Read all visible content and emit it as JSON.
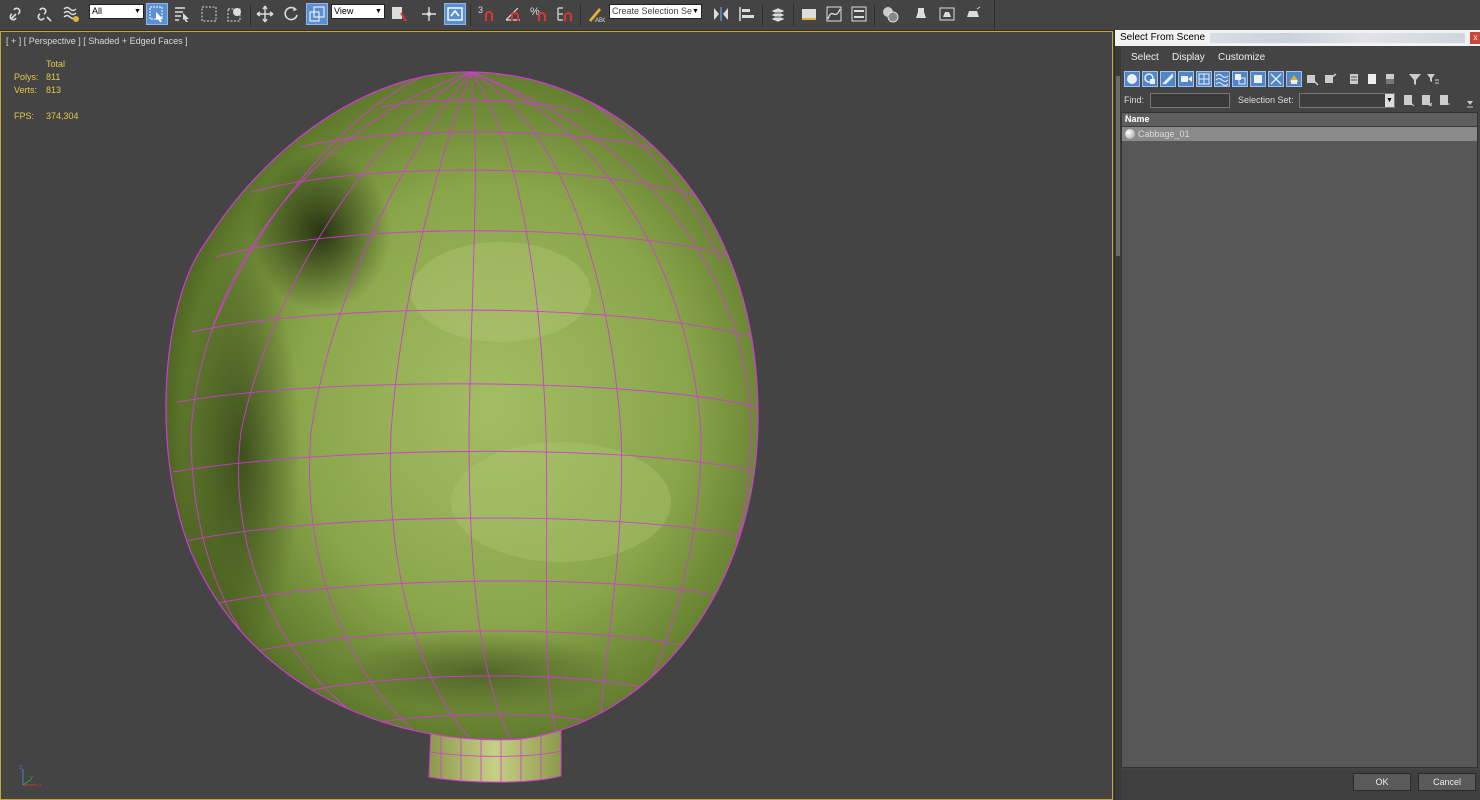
{
  "toolbar": {
    "selection_filter": "All",
    "reference_coord": "View",
    "named_selection_placeholder": "Create Selection Se",
    "snap_label": "3"
  },
  "viewport": {
    "label": "[ + ] [ Perspective ] [ Shaded + Edged Faces ]",
    "stats": {
      "total_label": "Total",
      "polys_label": "Polys:",
      "polys_value": "811",
      "verts_label": "Verts:",
      "verts_value": "813",
      "fps_label": "FPS:",
      "fps_value": "374,304"
    },
    "mesh_color": "#8aa64a",
    "wire_color": "#d23ad6",
    "axis": {
      "x": "x",
      "y": "y",
      "z": "z"
    }
  },
  "dialog": {
    "title": "Select From Scene",
    "menus": [
      "Select",
      "Display",
      "Customize"
    ],
    "find_label": "Find:",
    "find_value": "",
    "selection_set_label": "Selection Set:",
    "selection_set_value": "",
    "column_name": "Name",
    "sort_glyph": "/",
    "objects": [
      {
        "name": "Cabbage_01"
      }
    ],
    "ok_label": "OK",
    "cancel_label": "Cancel",
    "close_glyph": "x"
  },
  "colors": {
    "accent": "#5b8fd0",
    "viewport_border": "#c9a632",
    "stats_text": "#e4c84a"
  }
}
